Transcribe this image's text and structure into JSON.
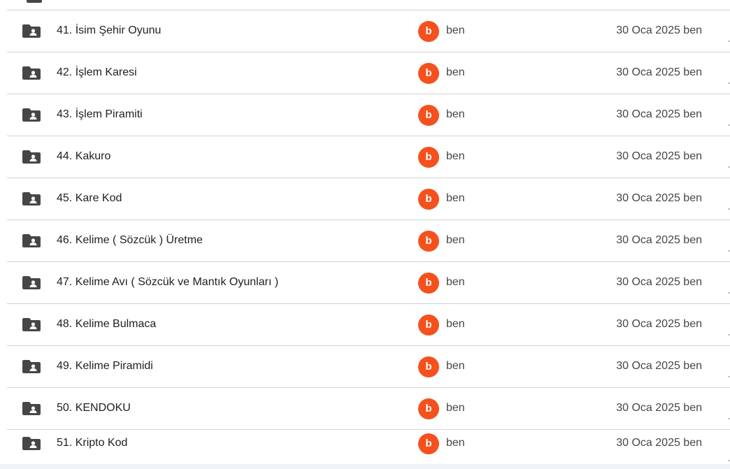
{
  "colors": {
    "avatar_bg": "#f4511e",
    "folder_icon": "#444746",
    "divider": "#d3d3d3"
  },
  "icons": {
    "folder": "shared-folder-icon"
  },
  "files": [
    {
      "name": "41. İsim Şehir Oyunu",
      "avatar": "b",
      "owner": "ben",
      "modified": "30 Oca 2025 ben"
    },
    {
      "name": "42. İşlem Karesi",
      "avatar": "b",
      "owner": "ben",
      "modified": "30 Oca 2025 ben"
    },
    {
      "name": "43. İşlem Piramiti",
      "avatar": "b",
      "owner": "ben",
      "modified": "30 Oca 2025 ben"
    },
    {
      "name": "44. Kakuro",
      "avatar": "b",
      "owner": "ben",
      "modified": "30 Oca 2025 ben"
    },
    {
      "name": "45. Kare Kod",
      "avatar": "b",
      "owner": "ben",
      "modified": "30 Oca 2025 ben"
    },
    {
      "name": "46. Kelime ( Sözcük ) Üretme",
      "avatar": "b",
      "owner": "ben",
      "modified": "30 Oca 2025 ben"
    },
    {
      "name": "47. Kelime Avı ( Sözcük ve Mantık Oyunları )",
      "avatar": "b",
      "owner": "ben",
      "modified": "30 Oca 2025 ben"
    },
    {
      "name": "48. Kelime Bulmaca",
      "avatar": "b",
      "owner": "ben",
      "modified": "30 Oca 2025 ben"
    },
    {
      "name": "49. Kelime Piramidi",
      "avatar": "b",
      "owner": "ben",
      "modified": "30 Oca 2025 ben"
    },
    {
      "name": "50. KENDOKU",
      "avatar": "b",
      "owner": "ben",
      "modified": "30 Oca 2025 ben"
    },
    {
      "name": "51. Kripto Kod",
      "avatar": "b",
      "owner": "ben",
      "modified": "30 Oca 2025 ben"
    }
  ]
}
